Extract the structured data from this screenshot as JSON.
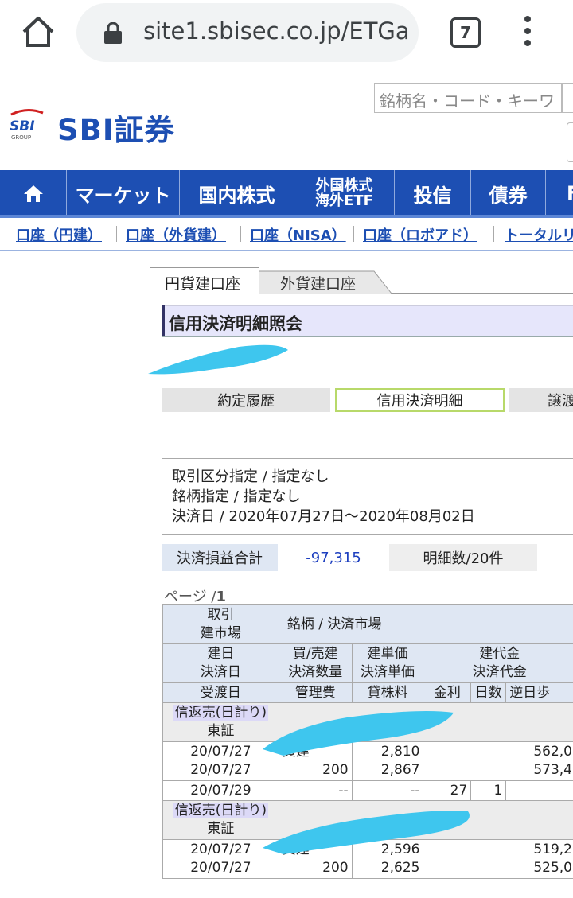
{
  "browser": {
    "url": "site1.sbisec.co.jp/ETGa",
    "tab_count": "7"
  },
  "header": {
    "logo_mark": "SBI",
    "logo_group": "GROUP",
    "logo_text": "SBI証券",
    "search_placeholder": "銘柄名・コード・キーワ"
  },
  "nav": {
    "items": [
      "マーケット",
      "国内株式",
      "外国株式",
      "海外ETF",
      "投信",
      "債券",
      "F"
    ]
  },
  "sublinks": [
    "口座（円建）",
    "口座（外貨建）",
    "口座（NISA）",
    "口座（ロボアド）",
    "トータルリ"
  ],
  "tabs": {
    "yen": "円貨建口座",
    "fx": "外貨建口座"
  },
  "page": {
    "title": "信用決済明細照会",
    "subtabs": [
      "約定履歴",
      "信用決済明細",
      "譲渡"
    ],
    "conditions": [
      "取引区分指定 / 指定なし",
      "銘柄指定 /  指定なし",
      "決済日 / 2020年07月27日〜2020年08月02日"
    ],
    "sum_label": "決済損益合計",
    "sum_value": "-97,315",
    "count": "明細数/20件",
    "page_indicator_prefix": "ページ /",
    "page_indicator_num": "1"
  },
  "table": {
    "h1_col1": [
      "取引",
      "建市場"
    ],
    "h1_col2": "銘柄 / 決済市場",
    "h2_col1": [
      "建日",
      "決済日"
    ],
    "h2_col2": [
      "買/売建",
      "決済数量"
    ],
    "h2_col3": [
      "建単価",
      "決済単価"
    ],
    "h2_col4": [
      "建代金",
      "決済代金"
    ],
    "h3": [
      "受渡日",
      "管理費",
      "貸株料",
      "金利",
      "日数",
      "逆日歩"
    ],
    "groups": [
      {
        "type": "信返売(日計り)",
        "market": "東証",
        "dates": [
          "20/07/27",
          "20/07/27"
        ],
        "side": "買建",
        "qty": "200",
        "prices": [
          "2,810",
          "2,867"
        ],
        "amounts": [
          "562,0",
          "573,4"
        ],
        "settle_date": "20/07/29",
        "mgmt_fee": "--",
        "lending_fee": "--",
        "interest": "27",
        "days": "1"
      },
      {
        "type": "信返売(日計り)",
        "market": "東証",
        "dates": [
          "20/07/27",
          "20/07/27"
        ],
        "side": "買建",
        "qty": "200",
        "prices": [
          "2,596",
          "2,625"
        ],
        "amounts": [
          "519,2",
          "525,0"
        ]
      }
    ]
  },
  "colors": {
    "brand_blue": "#1d4fb3",
    "redaction": "#3ec6ee"
  }
}
